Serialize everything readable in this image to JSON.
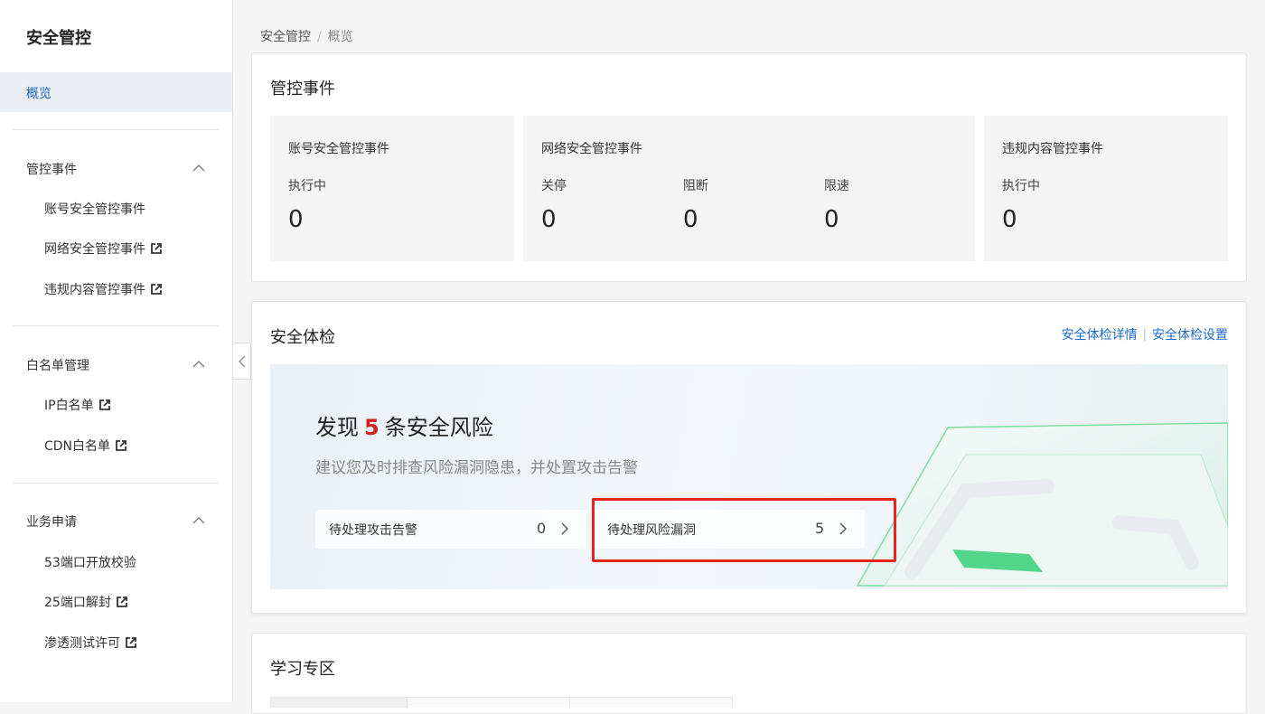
{
  "sidebar": {
    "title": "安全管控",
    "overview": "概览",
    "groups": [
      {
        "label": "管控事件",
        "items": [
          {
            "label": "账号安全管控事件",
            "external": false
          },
          {
            "label": "网络安全管控事件",
            "external": true
          },
          {
            "label": "违规内容管控事件",
            "external": true
          }
        ]
      },
      {
        "label": "白名单管理",
        "items": [
          {
            "label": "IP白名单",
            "external": true
          },
          {
            "label": "CDN白名单",
            "external": true
          }
        ]
      },
      {
        "label": "业务申请",
        "items": [
          {
            "label": "53端口开放校验",
            "external": false
          },
          {
            "label": "25端口解封",
            "external": true
          },
          {
            "label": "渗透测试许可",
            "external": true
          }
        ]
      }
    ]
  },
  "breadcrumb": {
    "root": "安全管控",
    "separator": "/",
    "current": "概览"
  },
  "events_card": {
    "title": "管控事件",
    "account": {
      "title": "账号安全管控事件",
      "label": "执行中",
      "value": "0"
    },
    "network": {
      "title": "网络安全管控事件",
      "stats": [
        {
          "label": "关停",
          "value": "0"
        },
        {
          "label": "阻断",
          "value": "0"
        },
        {
          "label": "限速",
          "value": "0"
        }
      ]
    },
    "content": {
      "title": "违规内容管控事件",
      "label": "执行中",
      "value": "0"
    }
  },
  "check_card": {
    "title": "安全体检",
    "link_details": "安全体检详情",
    "link_divider": "|",
    "link_settings": "安全体检设置",
    "headline_prefix": "发现",
    "headline_count": "5",
    "headline_suffix": "条安全风险",
    "subtitle": "建议您及时排查风险漏洞隐患，并处置攻击告警",
    "alerts": {
      "label": "待处理攻击告警",
      "value": "0"
    },
    "vulns": {
      "label": "待处理风险漏洞",
      "value": "5"
    }
  },
  "learn_card": {
    "title": "学习专区"
  },
  "colors": {
    "accent": "#1f68c9",
    "risk": "#d42020",
    "highlight_box": "#e6231f"
  }
}
